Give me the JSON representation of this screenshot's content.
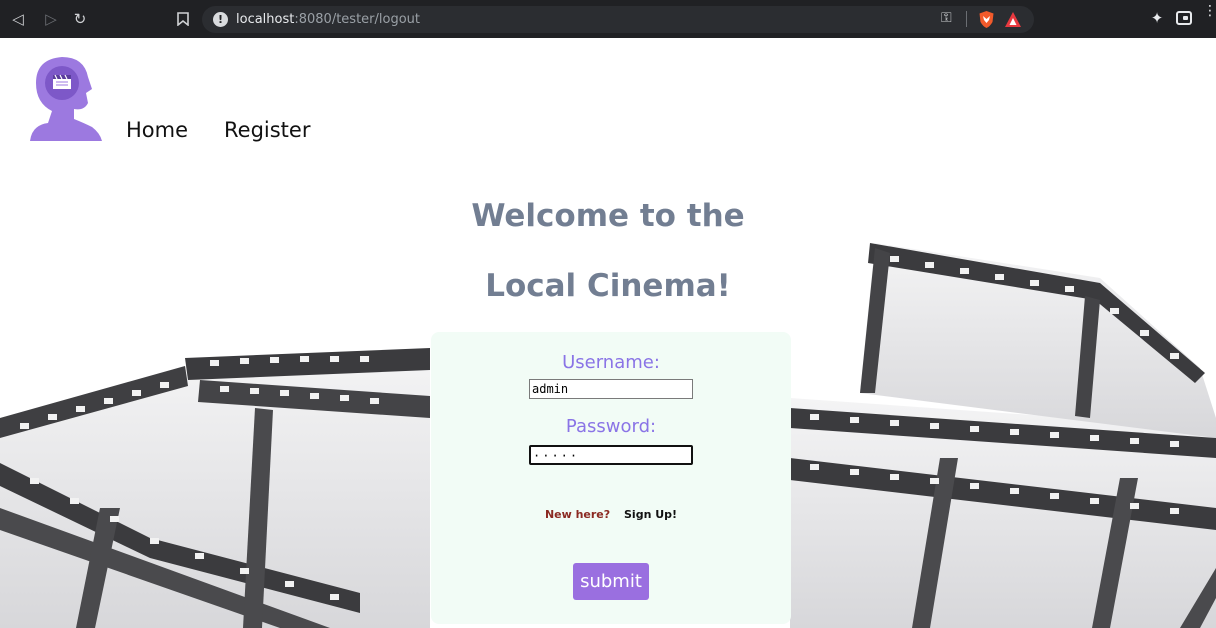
{
  "browser": {
    "url_host": "localhost",
    "url_rest": ":8080/tester/logout",
    "icons": [
      "back-icon",
      "forward-icon",
      "reload-icon",
      "bookmark-icon",
      "site-info-icon",
      "key-icon",
      "brave-shield-icon",
      "brave-rewards-icon",
      "extensions-icon",
      "wallet-icon",
      "menu-icon"
    ]
  },
  "nav": {
    "home_label": "Home",
    "register_label": "Register"
  },
  "hero": {
    "line1": "Welcome to the",
    "line2": "Local Cinema!"
  },
  "login": {
    "username_label": "Username:",
    "username_value": "admin",
    "password_label": "Password:",
    "password_masked": "·····",
    "new_here": "New here?",
    "sign_up": "Sign Up!",
    "submit_label": "submit"
  },
  "colors": {
    "heading": "#727e92",
    "label": "#8a74e6",
    "card": "#f2fcf6",
    "button": "#9a6fe0",
    "logo": "#9c79e0"
  }
}
